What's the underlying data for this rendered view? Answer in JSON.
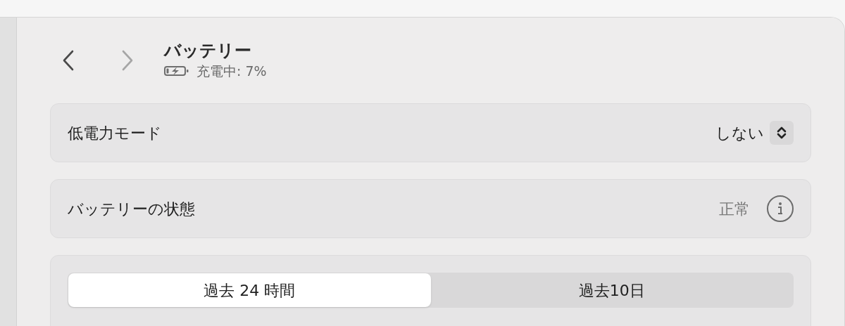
{
  "navigation": {
    "back": {
      "disabled": false
    },
    "forward": {
      "disabled": true
    }
  },
  "header": {
    "title": "バッテリー",
    "status": "充電中: 7%",
    "charging": true
  },
  "settings": [
    {
      "kind": "popup",
      "label": "低電力モード",
      "value": "しない"
    },
    {
      "kind": "info",
      "label": "バッテリーの状態",
      "value": "正常"
    }
  ],
  "range_tabs": [
    {
      "label": "過去 24 時間",
      "selected": true
    },
    {
      "label": "過去10日",
      "selected": false
    }
  ]
}
